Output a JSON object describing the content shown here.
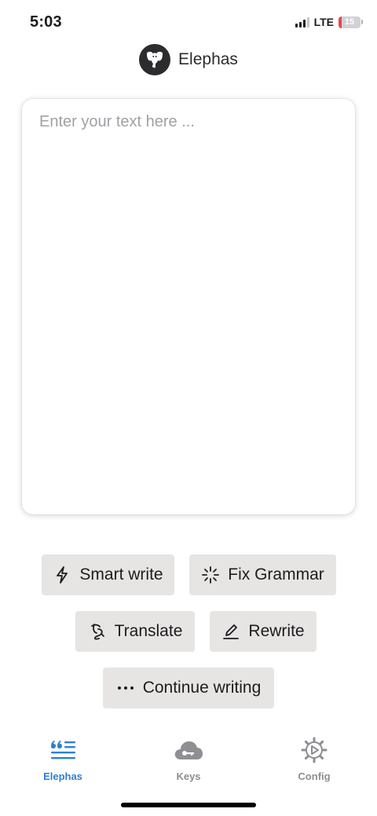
{
  "status_bar": {
    "time": "5:03",
    "network": "LTE",
    "battery_level": "15",
    "battery_fraction": 0.15,
    "battery_color": "#e5484d"
  },
  "header": {
    "title": "Elephas",
    "logo_icon": "elephant-logo-icon"
  },
  "editor": {
    "placeholder": "Enter your text here ...",
    "value": ""
  },
  "actions": {
    "smart_write": {
      "label": "Smart write",
      "icon": "lightning-icon"
    },
    "fix_grammar": {
      "label": "Fix Grammar",
      "icon": "sparkle-icon"
    },
    "translate": {
      "label": "Translate",
      "icon": "translate-icon"
    },
    "rewrite": {
      "label": "Rewrite",
      "icon": "pen-icon"
    },
    "continue_writing": {
      "label": "Continue writing",
      "icon": "ellipsis-icon"
    }
  },
  "tabs": [
    {
      "label": "Elephas",
      "icon": "quote-list-icon",
      "active": true
    },
    {
      "label": "Keys",
      "icon": "cloud-key-icon",
      "active": false
    },
    {
      "label": "Config",
      "icon": "gear-play-icon",
      "active": false
    }
  ],
  "colors": {
    "accent": "#2f7fd3",
    "button_bg": "#e6e5e4",
    "inactive_tab": "#8e8e93"
  }
}
